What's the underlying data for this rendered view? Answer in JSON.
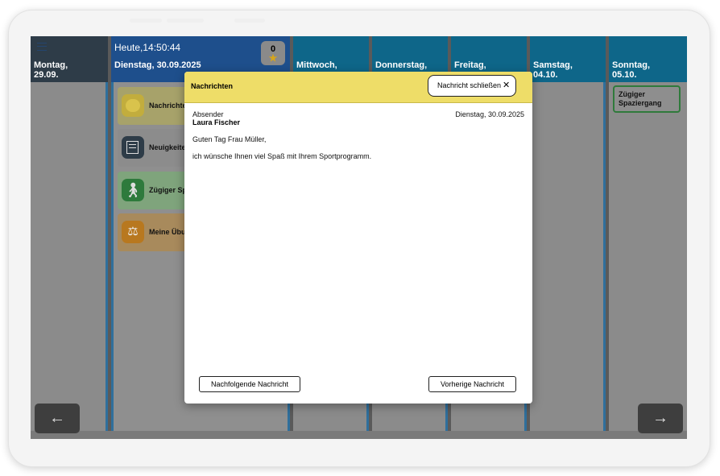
{
  "header": {
    "clock": "Heute,14:50:44",
    "today_date": "Dienstag, 30.09.2025",
    "badge_count": "0",
    "badge_icon": "star-icon"
  },
  "days": [
    {
      "l1": "Montag,",
      "l2": "29.09."
    },
    {
      "l1": "Mittwoch,",
      "l2": ""
    },
    {
      "l1": "Donnerstag,",
      "l2": ""
    },
    {
      "l1": "Freitag,",
      "l2": ""
    },
    {
      "l1": "Samstag,",
      "l2": "04.10."
    },
    {
      "l1": "Sonntag,",
      "l2": "05.10."
    }
  ],
  "tiles": [
    {
      "label": "Nachrichten",
      "icon": "message-bubble-icon"
    },
    {
      "label": "Neuigkeiten",
      "icon": "newspaper-icon"
    },
    {
      "label": "Zügiger Spaz",
      "icon": "walking-person-icon"
    },
    {
      "label": "Meine Übung",
      "icon": "balance-scale-icon"
    }
  ],
  "sunday_event": {
    "line1": "Zügiger",
    "line2": "Spaziergang"
  },
  "modal": {
    "title": "Nachrichten",
    "close_label": "Nachricht schließen",
    "close_glyph": "✕",
    "sender_label": "Absender",
    "sender_name": "Laura Fischer",
    "date": "Dienstag, 30.09.2025",
    "greeting": "Guten Tag Frau Müller,",
    "body": "ich wünsche Ihnen viel Spaß mit Ihrem Sportprogramm.",
    "next_label": "Nachfolgende Nachricht",
    "prev_label": "Vorherige Nachricht"
  },
  "nav": {
    "back_glyph": "←",
    "forward_glyph": "→"
  },
  "colors": {
    "monday_header": "#2e3c48",
    "today_header": "#1e4f8c",
    "week_header": "#0e6689",
    "modal_header": "#eedd68"
  }
}
